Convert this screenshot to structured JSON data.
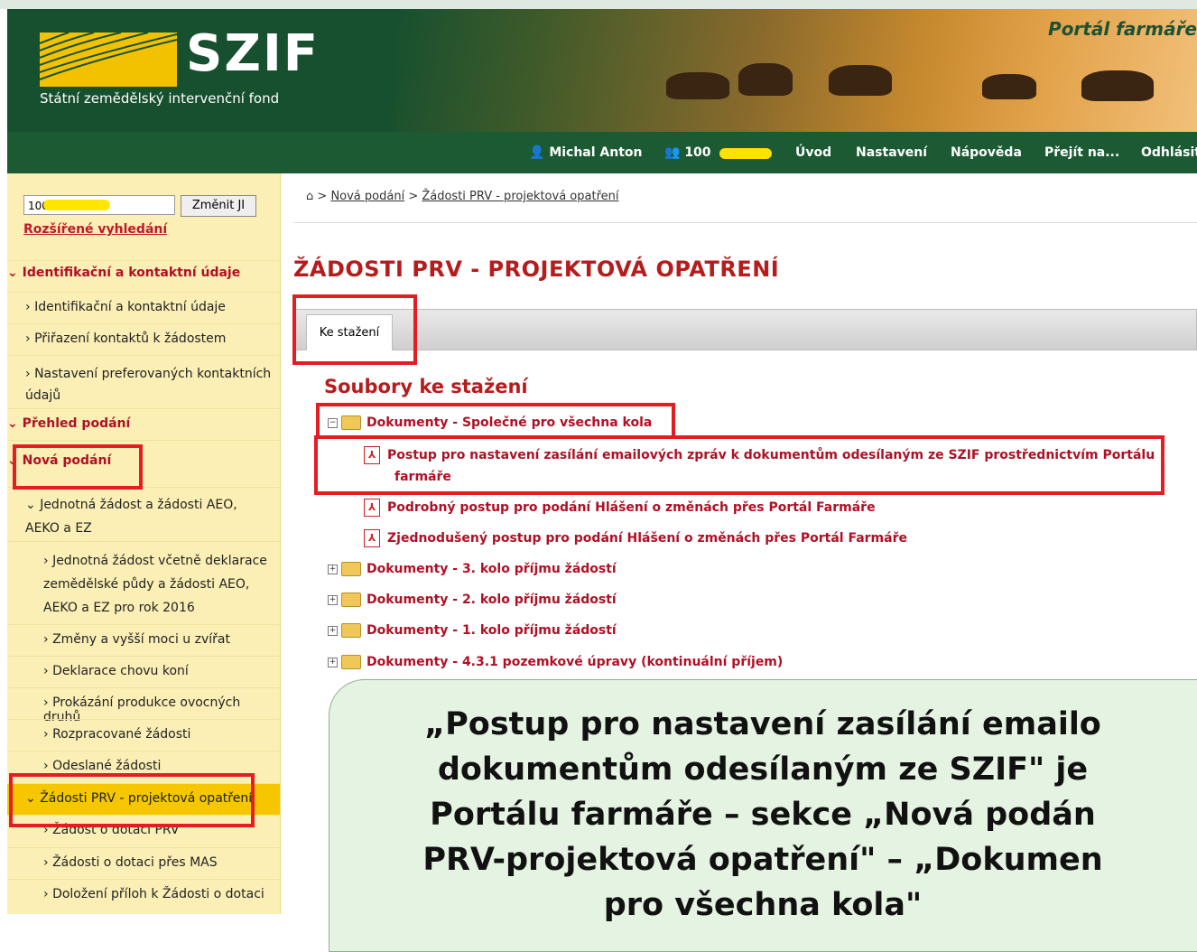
{
  "header": {
    "logo_text": "SZIF",
    "logo_subtitle": "Státní zemědělský intervenční fond",
    "portal_title": "Portál farmáře"
  },
  "nav": {
    "user": "Michal Anton",
    "client_id": "100",
    "items": [
      "Úvod",
      "Nastavení",
      "Nápověda",
      "Přejít na...",
      "Odhlásit"
    ]
  },
  "sidebar": {
    "search_value": "100",
    "change_button": "Změnit JI",
    "advanced_search": "Rozšířené vyhledání",
    "items": [
      {
        "label": "Identifikační a kontaktní údaje",
        "type": "section"
      },
      {
        "label": "Identifikační a kontaktní údaje",
        "type": "item"
      },
      {
        "label": "Přiřazení kontaktů k žádostem",
        "type": "item"
      },
      {
        "label": "Nastavení preferovaných kontaktních údajů",
        "type": "item"
      },
      {
        "label": "Přehled podání",
        "type": "section"
      },
      {
        "label": "Nová podání",
        "type": "section"
      },
      {
        "label": "Jednotná žádost a žádosti AEO, AEKO a EZ",
        "type": "sub"
      },
      {
        "label": "Jednotná žádost včetně deklarace zemědělské půdy a žádosti AEO, AEKO a EZ pro rok 2016",
        "type": "subsub"
      },
      {
        "label": "Změny a vyšší moci u zvířat",
        "type": "subsub"
      },
      {
        "label": "Deklarace chovu koní",
        "type": "subsub"
      },
      {
        "label": "Prokázání produkce ovocných druhů",
        "type": "subsub"
      },
      {
        "label": "Rozpracované žádosti",
        "type": "subsub"
      },
      {
        "label": "Odeslané žádosti",
        "type": "subsub"
      },
      {
        "label": "Žádosti PRV - projektová opatření",
        "type": "sub-active"
      },
      {
        "label": "Žádost o dotaci PRV",
        "type": "subsub"
      },
      {
        "label": "Žádosti o dotaci přes MAS",
        "type": "subsub"
      },
      {
        "label": "Doložení příloh k Žádosti o dotaci",
        "type": "subsub"
      }
    ]
  },
  "breadcrumb": {
    "link1": "Nová podání",
    "link2": "Žádosti PRV - projektová opatření"
  },
  "main": {
    "title": "ŽÁDOSTI PRV - PROJEKTOVÁ OPATŘENÍ",
    "tab": "Ke stažení",
    "section_title": "Soubory ke stažení",
    "tree": {
      "root": "Dokumenty - Společné pro všechna kola",
      "files": [
        "Postup pro nastavení zasílání emailových zpráv k dokumentům odesílaným ze SZIF prostřednictvím Portálu",
        "farmáře",
        "Podrobný postup pro podání Hlášení o změnách přes Portál Farmáře",
        "Zjednodušený postup pro podání Hlášení o změnách přes Portál Farmáře"
      ],
      "folders": [
        "Dokumenty - 3. kolo příjmu žádostí",
        "Dokumenty - 2. kolo příjmu žádostí",
        "Dokumenty - 1. kolo příjmu žádostí",
        "Dokumenty - 4.3.1 pozemkové úpravy (kontinuální příjem)"
      ]
    }
  },
  "callout": {
    "lines": [
      "„Postup pro nastavení zasílání emailo",
      "dokumentům odesílaným ze SZIF\" je",
      "Portálu farmáře – sekce „Nová podán",
      "PRV-projektová opatření\" – „Dokumen",
      "pro všechna kola\""
    ]
  }
}
